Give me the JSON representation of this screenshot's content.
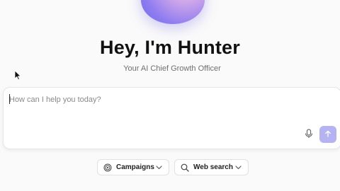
{
  "hero": {
    "title": "Hey, I'm Hunter",
    "subtitle": "Your AI Chief Growth Officer",
    "orb_colors": [
      "#f2c8e4",
      "#c9a3ea",
      "#8f7cf0",
      "#6d6be8"
    ]
  },
  "chat": {
    "placeholder": "How can I help you today?",
    "value": "",
    "mic_icon": "microphone-icon",
    "send_icon": "arrow-up-icon",
    "send_color": "#b6b3f2"
  },
  "chips": [
    {
      "label": "Campaigns",
      "icon": "target-icon"
    },
    {
      "label": "Web search",
      "icon": "search-icon"
    }
  ]
}
